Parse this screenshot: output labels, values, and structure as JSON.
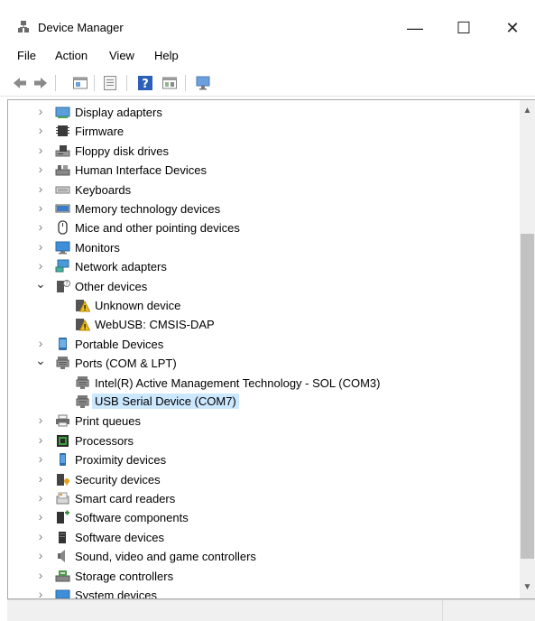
{
  "window": {
    "title": "Device Manager",
    "minimize_glyph": "—",
    "maximize_glyph": "☐",
    "close_glyph": "✕"
  },
  "menu": [
    "File",
    "Action",
    "View",
    "Help"
  ],
  "toolbar": [
    "back-icon",
    "forward-icon",
    "properties-icon",
    "list-icon",
    "help-icon",
    "details-icon",
    "monitor-icon"
  ],
  "tree": {
    "rows": [
      {
        "label": "Display adapters",
        "level": 0,
        "state": "collapsed",
        "icon": "display-adapter-icon"
      },
      {
        "label": "Firmware",
        "level": 0,
        "state": "collapsed",
        "icon": "firmware-icon"
      },
      {
        "label": "Floppy disk drives",
        "level": 0,
        "state": "collapsed",
        "icon": "floppy-drive-icon"
      },
      {
        "label": "Human Interface Devices",
        "level": 0,
        "state": "collapsed",
        "icon": "hid-icon"
      },
      {
        "label": "Keyboards",
        "level": 0,
        "state": "collapsed",
        "icon": "keyboard-icon"
      },
      {
        "label": "Memory technology devices",
        "level": 0,
        "state": "collapsed",
        "icon": "memory-icon"
      },
      {
        "label": "Mice and other pointing devices",
        "level": 0,
        "state": "collapsed",
        "icon": "mouse-icon"
      },
      {
        "label": "Monitors",
        "level": 0,
        "state": "collapsed",
        "icon": "monitor-icon"
      },
      {
        "label": "Network adapters",
        "level": 0,
        "state": "collapsed",
        "icon": "network-icon"
      },
      {
        "label": "Other devices",
        "level": 0,
        "state": "expanded",
        "icon": "other-devices-icon"
      },
      {
        "label": "Unknown device",
        "level": 1,
        "state": "leaf",
        "icon": "warning-device-icon"
      },
      {
        "label": "WebUSB: CMSIS-DAP",
        "level": 1,
        "state": "leaf",
        "icon": "warning-device-icon"
      },
      {
        "label": "Portable Devices",
        "level": 0,
        "state": "collapsed",
        "icon": "portable-device-icon"
      },
      {
        "label": "Ports (COM & LPT)",
        "level": 0,
        "state": "expanded",
        "icon": "port-icon"
      },
      {
        "label": "Intel(R) Active Management Technology - SOL (COM3)",
        "level": 1,
        "state": "leaf",
        "icon": "port-icon"
      },
      {
        "label": "USB Serial Device (COM7)",
        "level": 1,
        "state": "leaf",
        "icon": "port-icon",
        "selected": true
      },
      {
        "label": "Print queues",
        "level": 0,
        "state": "collapsed",
        "icon": "printer-icon"
      },
      {
        "label": "Processors",
        "level": 0,
        "state": "collapsed",
        "icon": "processor-icon"
      },
      {
        "label": "Proximity devices",
        "level": 0,
        "state": "collapsed",
        "icon": "proximity-icon"
      },
      {
        "label": "Security devices",
        "level": 0,
        "state": "collapsed",
        "icon": "security-icon"
      },
      {
        "label": "Smart card readers",
        "level": 0,
        "state": "collapsed",
        "icon": "smart-card-icon"
      },
      {
        "label": "Software components",
        "level": 0,
        "state": "collapsed",
        "icon": "software-component-icon"
      },
      {
        "label": "Software devices",
        "level": 0,
        "state": "collapsed",
        "icon": "software-device-icon"
      },
      {
        "label": "Sound, video and game controllers",
        "level": 0,
        "state": "collapsed",
        "icon": "sound-icon"
      },
      {
        "label": "Storage controllers",
        "level": 0,
        "state": "collapsed",
        "icon": "storage-icon"
      },
      {
        "label": "System devices",
        "level": 0,
        "state": "collapsed",
        "icon": "system-icon"
      }
    ]
  },
  "colors": {
    "selection": "#cce8ff",
    "accent": "#1e7fd6"
  }
}
